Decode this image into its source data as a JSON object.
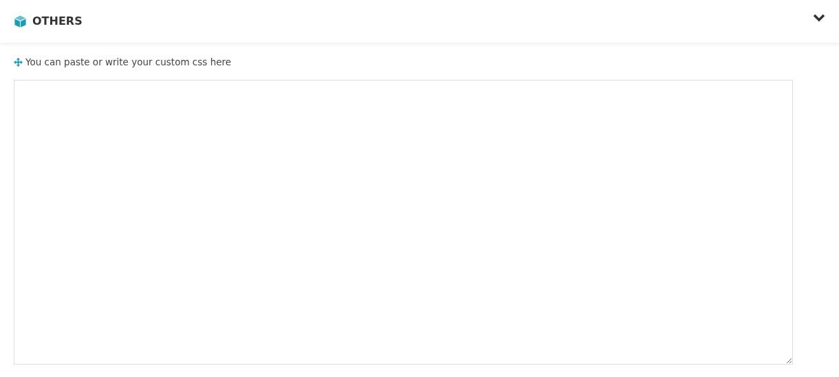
{
  "panel": {
    "title": "OTHERS",
    "hint": "You can paste or write your custom css here"
  }
}
